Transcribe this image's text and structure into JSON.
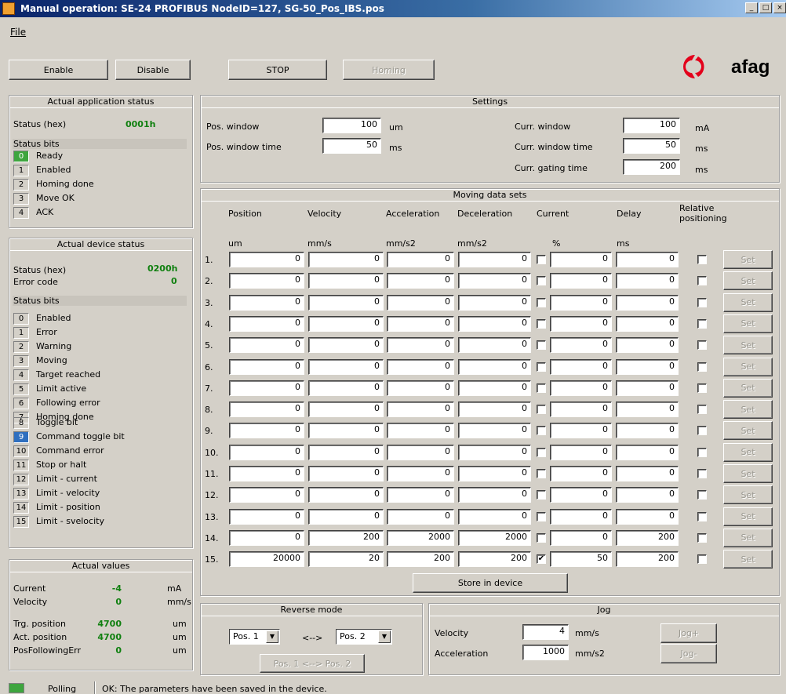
{
  "window": {
    "title": "Manual operation: SE-24 PROFIBUS NodeID=127, SG-50_Pos_IBS.pos",
    "min": "_",
    "max": "□",
    "close": "×"
  },
  "menu": {
    "file": "File"
  },
  "toolbar": {
    "enable": "Enable",
    "disable": "Disable",
    "stop": "STOP",
    "homing": "Homing"
  },
  "logo": {
    "text": "afag",
    "color": "#e3001b"
  },
  "app_status": {
    "title": "Actual application status",
    "status_hex_label": "Status (hex)",
    "status_hex_value": "0001h",
    "bits_label": "Status bits",
    "bits": [
      {
        "num": "0",
        "label": "Ready",
        "active": true
      },
      {
        "num": "1",
        "label": "Enabled",
        "active": false
      },
      {
        "num": "2",
        "label": "Homing done",
        "active": false
      },
      {
        "num": "3",
        "label": "Move OK",
        "active": false
      },
      {
        "num": "4",
        "label": "ACK",
        "active": false
      }
    ]
  },
  "device_status": {
    "title": "Actual device status",
    "status_hex_label": "Status (hex)",
    "status_hex_value": "0200h",
    "error_label": "Error code",
    "error_value": "0",
    "bits_label": "Status bits",
    "bits": [
      {
        "num": "0",
        "label": "Enabled"
      },
      {
        "num": "1",
        "label": "Error"
      },
      {
        "num": "2",
        "label": "Warning"
      },
      {
        "num": "3",
        "label": "Moving"
      },
      {
        "num": "4",
        "label": "Target reached"
      },
      {
        "num": "5",
        "label": "Limit active"
      },
      {
        "num": "6",
        "label": "Following error"
      },
      {
        "num": "7",
        "label": "Homing done"
      },
      {
        "num": "8",
        "label": "Toggle bit"
      },
      {
        "num": "9",
        "label": "Command toggle bit",
        "active": true
      },
      {
        "num": "10",
        "label": "Command error"
      },
      {
        "num": "11",
        "label": "Stop or halt"
      },
      {
        "num": "12",
        "label": "Limit - current"
      },
      {
        "num": "13",
        "label": "Limit - velocity"
      },
      {
        "num": "14",
        "label": "Limit - position"
      },
      {
        "num": "15",
        "label": "Limit - svelocity"
      }
    ]
  },
  "actual_values": {
    "title": "Actual values",
    "rows": [
      {
        "label": "Current",
        "value": "-4",
        "unit": "mA"
      },
      {
        "label": "Velocity",
        "value": "0",
        "unit": "mm/s"
      },
      {
        "label": "Trg. position",
        "value": "4700",
        "unit": "um"
      },
      {
        "label": "Act. position",
        "value": "4700",
        "unit": "um"
      },
      {
        "label": "PosFollowingErr",
        "value": "0",
        "unit": "um"
      }
    ]
  },
  "settings": {
    "title": "Settings",
    "pos_window_label": "Pos. window",
    "pos_window_value": "100",
    "pos_window_unit": "um",
    "pos_window_time_label": "Pos. window time",
    "pos_window_time_value": "50",
    "pos_window_time_unit": "ms",
    "curr_window_label": "Curr. window",
    "curr_window_value": "100",
    "curr_window_unit": "mA",
    "curr_window_time_label": "Curr. window time",
    "curr_window_time_value": "50",
    "curr_window_time_unit": "ms",
    "curr_gating_label": "Curr. gating time",
    "curr_gating_value": "200",
    "curr_gating_unit": "ms"
  },
  "moving": {
    "title": "Moving data sets",
    "headers": [
      "Position",
      "Velocity",
      "Acceleration",
      "Deceleration",
      "Current",
      "Delay",
      "Relative positioning"
    ],
    "units": [
      "um",
      "mm/s",
      "mm/s2",
      "mm/s2",
      "%",
      "ms"
    ],
    "set_label": "Set",
    "store_label": "Store in device",
    "rows": [
      {
        "n": "1.",
        "pos": "0",
        "vel": "0",
        "acc": "0",
        "dec": "0",
        "cur_chk": "",
        "cur": "0",
        "delay": "0",
        "rel": ""
      },
      {
        "n": "2.",
        "pos": "0",
        "vel": "0",
        "acc": "0",
        "dec": "0",
        "cur_chk": "",
        "cur": "0",
        "delay": "0",
        "rel": ""
      },
      {
        "n": "3.",
        "pos": "0",
        "vel": "0",
        "acc": "0",
        "dec": "0",
        "cur_chk": "",
        "cur": "0",
        "delay": "0",
        "rel": ""
      },
      {
        "n": "4.",
        "pos": "0",
        "vel": "0",
        "acc": "0",
        "dec": "0",
        "cur_chk": "",
        "cur": "0",
        "delay": "0",
        "rel": ""
      },
      {
        "n": "5.",
        "pos": "0",
        "vel": "0",
        "acc": "0",
        "dec": "0",
        "cur_chk": "",
        "cur": "0",
        "delay": "0",
        "rel": ""
      },
      {
        "n": "6.",
        "pos": "0",
        "vel": "0",
        "acc": "0",
        "dec": "0",
        "cur_chk": "",
        "cur": "0",
        "delay": "0",
        "rel": ""
      },
      {
        "n": "7.",
        "pos": "0",
        "vel": "0",
        "acc": "0",
        "dec": "0",
        "cur_chk": "",
        "cur": "0",
        "delay": "0",
        "rel": ""
      },
      {
        "n": "8.",
        "pos": "0",
        "vel": "0",
        "acc": "0",
        "dec": "0",
        "cur_chk": "",
        "cur": "0",
        "delay": "0",
        "rel": ""
      },
      {
        "n": "9.",
        "pos": "0",
        "vel": "0",
        "acc": "0",
        "dec": "0",
        "cur_chk": "",
        "cur": "0",
        "delay": "0",
        "rel": ""
      },
      {
        "n": "10.",
        "pos": "0",
        "vel": "0",
        "acc": "0",
        "dec": "0",
        "cur_chk": "",
        "cur": "0",
        "delay": "0",
        "rel": ""
      },
      {
        "n": "11.",
        "pos": "0",
        "vel": "0",
        "acc": "0",
        "dec": "0",
        "cur_chk": "",
        "cur": "0",
        "delay": "0",
        "rel": ""
      },
      {
        "n": "12.",
        "pos": "0",
        "vel": "0",
        "acc": "0",
        "dec": "0",
        "cur_chk": "",
        "cur": "0",
        "delay": "0",
        "rel": ""
      },
      {
        "n": "13.",
        "pos": "0",
        "vel": "0",
        "acc": "0",
        "dec": "0",
        "cur_chk": "",
        "cur": "0",
        "delay": "0",
        "rel": ""
      },
      {
        "n": "14.",
        "pos": "0",
        "vel": "200",
        "acc": "2000",
        "dec": "2000",
        "cur_chk": "",
        "cur": "0",
        "delay": "200",
        "rel": ""
      },
      {
        "n": "15.",
        "pos": "20000",
        "vel": "20",
        "acc": "200",
        "dec": "200",
        "cur_chk": "✔",
        "cur": "50",
        "delay": "200",
        "rel": ""
      }
    ]
  },
  "reverse": {
    "title": "Reverse mode",
    "pos1": "Pos. 1",
    "arrow": "<-->",
    "pos2": "Pos. 2",
    "button": "Pos. 1 <--> Pos. 2"
  },
  "jog": {
    "title": "Jog",
    "vel_label": "Velocity",
    "vel_value": "4",
    "vel_unit": "mm/s",
    "acc_label": "Acceleration",
    "acc_value": "1000",
    "acc_unit": "mm/s2",
    "jog_plus": "Jog+",
    "jog_minus": "Jog-"
  },
  "status": {
    "polling": "Polling",
    "message": "OK: The parameters have been saved in the device.",
    "indicator_color": "#3ea53e"
  }
}
